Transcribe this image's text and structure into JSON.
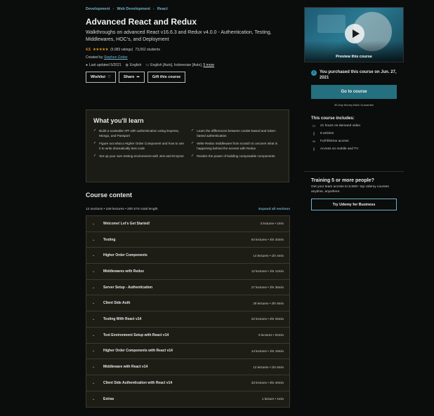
{
  "breadcrumb": [
    "Development",
    "Web Development",
    "React"
  ],
  "course": {
    "title": "Advanced React and Redux",
    "subtitle": "Walkthroughs on advanced React v16.6.3 and Redux v4.0.0 - Authentication, Testing, Middlewares, HOC's, and Deployment",
    "rating": "4.5",
    "stars": "★★★★★",
    "ratings_count": "(9,983 ratings)",
    "students": "73,062 students",
    "created_by_label": "Created by",
    "instructor": "Stephen Grider",
    "last_updated": "Last updated 5/2021",
    "language": "English",
    "captions": "English [Auto], Indonesian [Auto],",
    "captions_more": "5 more"
  },
  "actions": {
    "wishlist": "Wishlist",
    "share": "Share",
    "gift": "Gift this course"
  },
  "learn": {
    "heading": "What you'll learn",
    "items": [
      "Build a scaleable API with authentication using Express, Mongo, and Passport",
      "Learn the differences between cookie-based and token-based authentication",
      "Figure out what a Higher Order Component and how to use it to write dramatically less code",
      "Write Redux middleware from scratch to uncover what is happening behind the scenes with Redux",
      "Set up your own testing environment with Jest and Enzyme",
      "Realize the power of building composable components"
    ]
  },
  "content": {
    "heading": "Course content",
    "summary": "12 sections • 248 lectures • 20h 57m total length",
    "expand_label": "Expand all sections",
    "sections": [
      {
        "name": "Welcome! Let's Get Started!",
        "info": "3 lectures • 2min"
      },
      {
        "name": "Testing",
        "info": "64 lectures • 4hr 34min"
      },
      {
        "name": "Higher Order Components",
        "info": "14 lectures • 1hr 4min"
      },
      {
        "name": "Middlewares with Redux",
        "info": "12 lectures • 1hr 12min"
      },
      {
        "name": "Server Setup - Authentication",
        "info": "27 lectures • 2hr 36min"
      },
      {
        "name": "Client Side Auth",
        "info": "29 lectures • 2hr 8min"
      },
      {
        "name": "Testing With React v14",
        "info": "22 lectures • 2hr 26min"
      },
      {
        "name": "Test Environment Setup with React v14",
        "info": "9 lectures • 52min"
      },
      {
        "name": "Higher Order Components with React v14",
        "info": "14 lectures • 1hr 18min"
      },
      {
        "name": "Middleware with React v14",
        "info": "12 lectures • 1hr 6min"
      },
      {
        "name": "Client Side Authentication with React v14",
        "info": "33 lectures • 3hr 40min"
      },
      {
        "name": "Extras",
        "info": "1 lecture • 1min"
      }
    ]
  },
  "sidebar": {
    "preview_label": "Preview this course",
    "purchased": "You purchased this course on Jun. 27, 2021",
    "go_to_course": "Go to course",
    "guarantee": "30-Day Money-Back Guarantee",
    "includes_heading": "This course includes:",
    "includes": [
      {
        "icon": "video-icon",
        "text": "21 hours on-demand video"
      },
      {
        "icon": "file-icon",
        "text": "8 articles"
      },
      {
        "icon": "infinity-icon",
        "text": "Full lifetime access"
      },
      {
        "icon": "mobile-icon",
        "text": "Access on mobile and TV"
      }
    ]
  },
  "training": {
    "heading": "Training 5 or more people?",
    "text": "Get your team access to 5,500+ top Udemy courses anytime, anywhere.",
    "button": "Try Udemy for Business"
  },
  "colors": {
    "accent": "#6fb3c9",
    "button": "#24707f",
    "star": "#e59819",
    "panel": "#1d1d16"
  }
}
